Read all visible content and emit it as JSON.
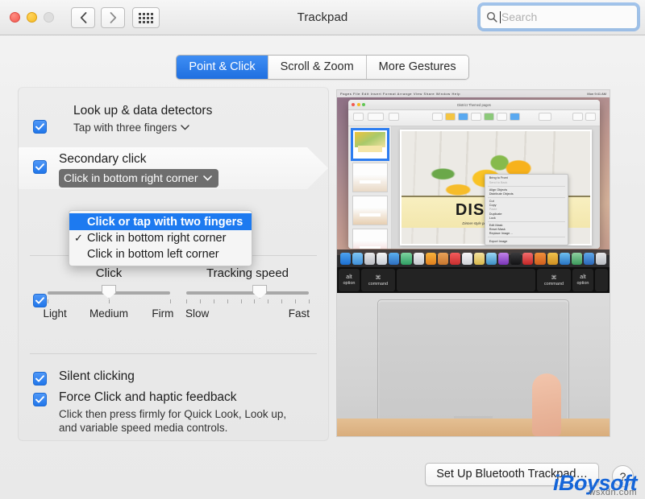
{
  "window": {
    "title": "Trackpad",
    "traffic_lights": [
      "close-red",
      "minimize-yellow",
      "zoom-disabled"
    ],
    "nav_back_label": "‹",
    "nav_forward_label": "›",
    "grid_button_name": "show-all-preferences"
  },
  "search": {
    "value": "",
    "placeholder": "Search",
    "focused": true
  },
  "tabs": [
    {
      "label": "Point & Click",
      "active": true
    },
    {
      "label": "Scroll & Zoom",
      "active": false
    },
    {
      "label": "More Gestures",
      "active": false
    }
  ],
  "options": {
    "lookup": {
      "title": "Look up & data detectors",
      "subtitle": "Tap with three fingers",
      "checked": true
    },
    "secondary_click": {
      "title": "Secondary click",
      "selected_value": "Click in bottom right corner",
      "checked": true,
      "selected": true,
      "menu": [
        {
          "label": "Click or tap with two fingers",
          "checked": false,
          "highlighted": true
        },
        {
          "label": "Click in bottom right corner",
          "checked": true,
          "highlighted": false
        },
        {
          "label": "Click in bottom left corner",
          "checked": false,
          "highlighted": false
        }
      ]
    },
    "hidden_row": {
      "checked": true
    }
  },
  "sliders": {
    "click": {
      "label": "Click",
      "ticks": [
        "Light",
        "Medium",
        "Firm"
      ],
      "value_percent": 50,
      "tick_count": 3
    },
    "tracking_speed": {
      "label": "Tracking speed",
      "min_label": "Slow",
      "max_label": "Fast",
      "value_percent": 60,
      "tick_count": 10
    }
  },
  "bottom_options": [
    {
      "label": "Silent clicking",
      "checked": true,
      "note": ""
    },
    {
      "label": "Force Click and haptic feedback",
      "checked": true,
      "note_line1": "Click then press firmly for Quick Look, Look up,",
      "note_line2": "and variable speed media controls."
    }
  ],
  "footer": {
    "bluetooth_button": "Set Up Bluetooth Trackpad…",
    "help_button": "?"
  },
  "watermark": {
    "main": "iBoysoft",
    "sub": "wsxdn.com"
  },
  "preview": {
    "app_menu": "Pages  File  Edit  Insert  Format  Arrange  View  Share  Window  Help",
    "menu_right": "Mon 9:41 AM",
    "document_title": "District Themed pages",
    "poster_heading": "DISTRICT",
    "poster_caption": "Dinner-style prepared food for your kitchen",
    "context_menu": [
      "Bring to Front",
      "Send to Back",
      "Align Objects",
      "Distribute Objects",
      "Cut",
      "Copy",
      "Paste",
      "Duplicate",
      "Lock",
      "Edit Mask",
      "Reset Mask",
      "Replace Image…",
      "Export Image"
    ],
    "keys": [
      {
        "sym": "alt",
        "name": "option"
      },
      {
        "sym": "⌘",
        "name": "command"
      },
      {
        "sym": "",
        "name": ""
      },
      {
        "sym": "⌘",
        "name": "command"
      },
      {
        "sym": "alt",
        "name": "option"
      }
    ]
  },
  "colors": {
    "accent_blue": "#1d7af0",
    "checkbox_blue": "#2076ea",
    "popup_gray": "#6e6e6e",
    "window_bg": "#ececec",
    "watermark_blue": "#1565d8"
  }
}
